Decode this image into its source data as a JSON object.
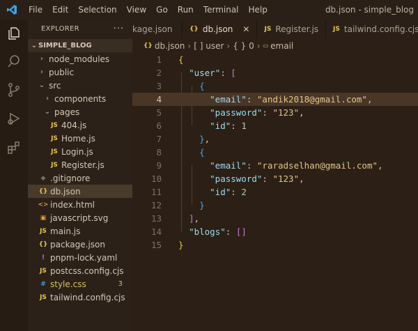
{
  "window": {
    "title": "db.json - simple_blog",
    "menu": [
      "File",
      "Edit",
      "Selection",
      "View",
      "Go",
      "Run",
      "Terminal",
      "Help"
    ]
  },
  "explorer": {
    "header": "EXPLORER",
    "more": "···",
    "root": "SIMPLE_BLOG",
    "items": [
      {
        "label": "node_modules",
        "type": "folder",
        "depth": 1,
        "expanded": false
      },
      {
        "label": "public",
        "type": "folder",
        "depth": 1,
        "expanded": false
      },
      {
        "label": "src",
        "type": "folder",
        "depth": 1,
        "expanded": true
      },
      {
        "label": "components",
        "type": "folder",
        "depth": 2,
        "expanded": false
      },
      {
        "label": "pages",
        "type": "folder",
        "depth": 2,
        "expanded": true
      },
      {
        "label": "404.js",
        "type": "js",
        "depth": 3
      },
      {
        "label": "Home.js",
        "type": "js",
        "depth": 3
      },
      {
        "label": "Login.js",
        "type": "js",
        "depth": 3
      },
      {
        "label": "Register.js",
        "type": "js",
        "depth": 3
      },
      {
        "label": ".gitignore",
        "type": "git",
        "depth": 1
      },
      {
        "label": "db.json",
        "type": "json",
        "depth": 1,
        "selected": true
      },
      {
        "label": "index.html",
        "type": "html",
        "depth": 1
      },
      {
        "label": "javascript.svg",
        "type": "svg",
        "depth": 1
      },
      {
        "label": "main.js",
        "type": "js",
        "depth": 1
      },
      {
        "label": "package.json",
        "type": "json",
        "depth": 1
      },
      {
        "label": "pnpm-lock.yaml",
        "type": "yaml",
        "depth": 1
      },
      {
        "label": "postcss.config.cjs",
        "type": "js",
        "depth": 1
      },
      {
        "label": "style.css",
        "type": "css",
        "depth": 1,
        "badge": "3"
      },
      {
        "label": "tailwind.config.cjs",
        "type": "js",
        "depth": 1
      }
    ]
  },
  "tabs": [
    {
      "label": "kage.json",
      "icon": "",
      "active": false
    },
    {
      "label": "db.json",
      "icon": "{}",
      "active": true,
      "close": "✕"
    },
    {
      "label": "Register.js",
      "icon": "JS",
      "active": false
    },
    {
      "label": "tailwind.config.cjs",
      "icon": "JS",
      "active": false
    }
  ],
  "breadcrumb": [
    "db.json",
    "[ ] user",
    "{ } 0",
    "email"
  ],
  "editor": {
    "current_line": 4,
    "lines": [
      "{",
      "  \"user\": [",
      "    {",
      "      \"email\": \"andik2018@gmail.com\",",
      "      \"password\": \"123\",",
      "      \"id\": 1",
      "    },",
      "    {",
      "      \"email\": \"raradselhan@gmail.com\",",
      "      \"password\": \"123\",",
      "      \"id\": 2",
      "    }",
      "  ],",
      "  \"blogs\": []",
      "}"
    ]
  },
  "colors": {
    "accent": "#4aa3e8",
    "json_icon": "#e8c84a",
    "badge_warning": "#d6c35a"
  }
}
